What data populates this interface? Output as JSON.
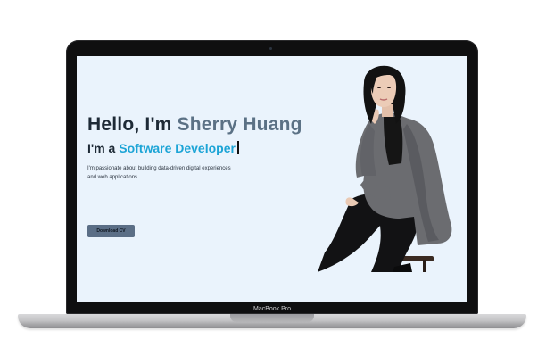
{
  "device": {
    "model_label": "MacBook Pro"
  },
  "hero": {
    "greeting_prefix": "Hello, I'm ",
    "name": "Sherry Huang",
    "role_prefix": "I'm a ",
    "role_title": "Software Developer",
    "description": "I'm passionate about building data-driven digital experiences and web applications.",
    "cta_label": "Download CV"
  },
  "theme": {
    "screen_background": "#eaf3fc",
    "heading_color": "#1e2a36",
    "name_color": "#5b7185",
    "role_accent_color": "#1ca4d6",
    "button_color": "#5b6e86"
  }
}
